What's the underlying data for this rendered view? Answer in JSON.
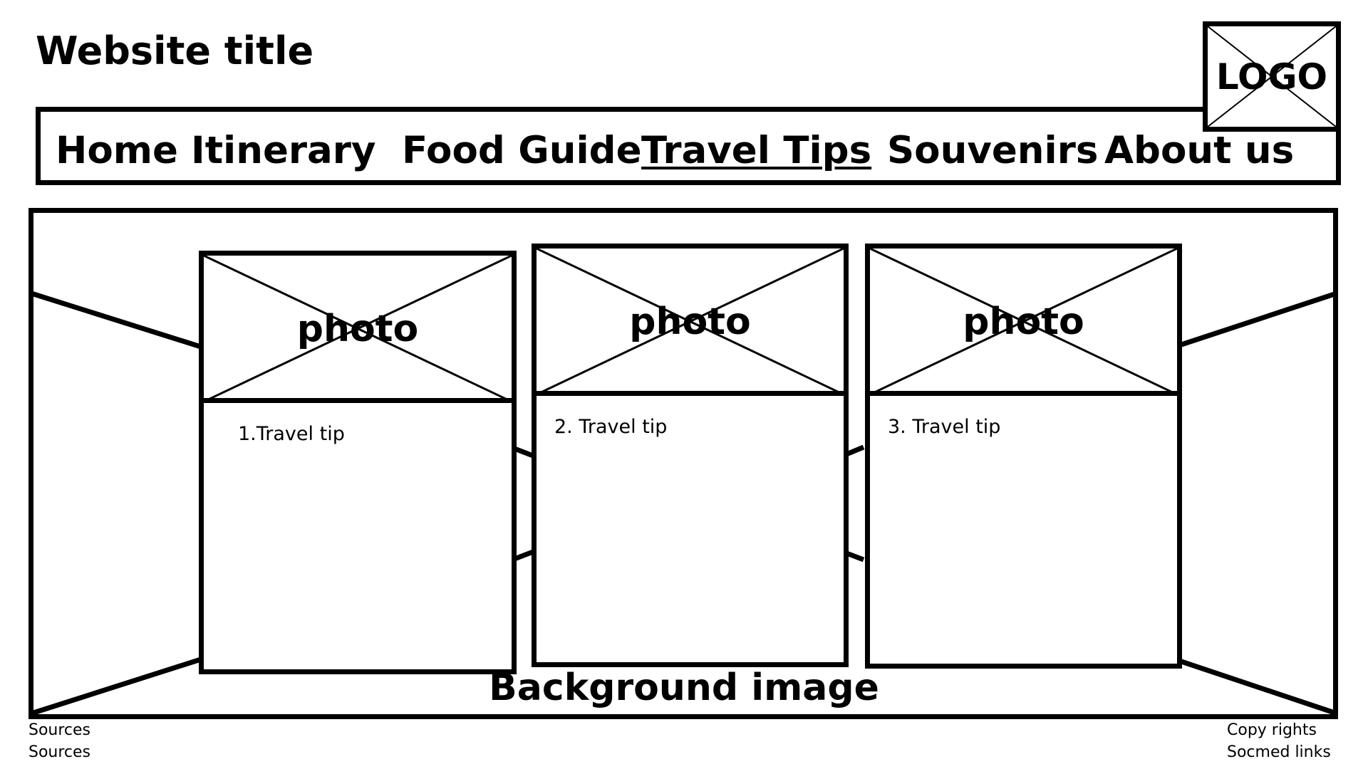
{
  "header": {
    "site_title": "Website title",
    "logo_label": "LOGO"
  },
  "nav": {
    "items": [
      {
        "label": "Home"
      },
      {
        "label": "Itinerary"
      },
      {
        "label": "Food Guide"
      },
      {
        "label": "Travel Tips",
        "active": true
      },
      {
        "label": "Souvenirs"
      },
      {
        "label": "About us"
      }
    ]
  },
  "main": {
    "background_label": "Background image",
    "cards": [
      {
        "photo_label": "photo",
        "tip": "1.Travel tip"
      },
      {
        "photo_label": "photo",
        "tip": "2. Travel tip"
      },
      {
        "photo_label": "photo",
        "tip": "3. Travel tip"
      }
    ]
  },
  "footer": {
    "left": [
      "Sources",
      "Sources"
    ],
    "right": [
      "Copy rights",
      "Socmed links"
    ]
  }
}
